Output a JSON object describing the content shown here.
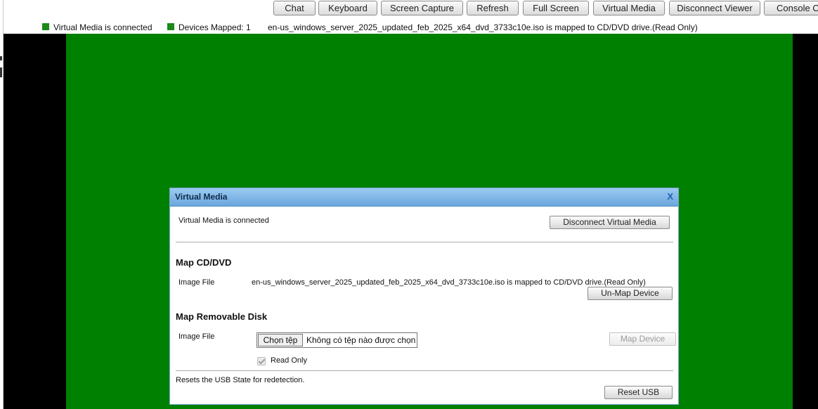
{
  "toolbar": {
    "buttons": [
      {
        "id": "chat",
        "label": "Chat"
      },
      {
        "id": "keyboard",
        "label": "Keyboard"
      },
      {
        "id": "screen-capture",
        "label": "Screen Capture"
      },
      {
        "id": "refresh",
        "label": "Refresh"
      },
      {
        "id": "full-screen",
        "label": "Full Screen"
      },
      {
        "id": "virtual-media",
        "label": "Virtual Media"
      },
      {
        "id": "disconnect-viewer",
        "label": "Disconnect Viewer"
      },
      {
        "id": "console-control",
        "label": "Console Co"
      }
    ]
  },
  "status": {
    "vm_connected": "Virtual Media is connected",
    "devices_mapped": "Devices Mapped: 1",
    "mapped_message": "en-us_windows_server_2025_updated_feb_2025_x64_dvd_3733c10e.iso is mapped to CD/DVD drive.(Read Only)",
    "indicator_color": "#1a8a1a"
  },
  "screen": {
    "background_color": "#008000"
  },
  "dialog": {
    "title": "Virtual Media",
    "close_label": "X",
    "connected_text": "Virtual Media is connected",
    "disconnect_label": "Disconnect Virtual Media",
    "cd_section": {
      "heading": "Map CD/DVD",
      "image_file_label": "Image File",
      "mapped_text": "en-us_windows_server_2025_updated_feb_2025_x64_dvd_3733c10e.iso is mapped to CD/DVD drive.(Read Only)",
      "unmap_label": "Un-Map Device"
    },
    "removable_section": {
      "heading": "Map Removable Disk",
      "image_file_label": "Image File",
      "choose_file_label": "Chọn tệp",
      "no_file_text": "Không có tệp nào được chọn",
      "map_device_label": "Map Device",
      "read_only_label": "Read Only",
      "read_only_checked": true
    },
    "usb": {
      "reset_text": "Resets the USB State for redetection.",
      "reset_label": "Reset USB"
    }
  }
}
